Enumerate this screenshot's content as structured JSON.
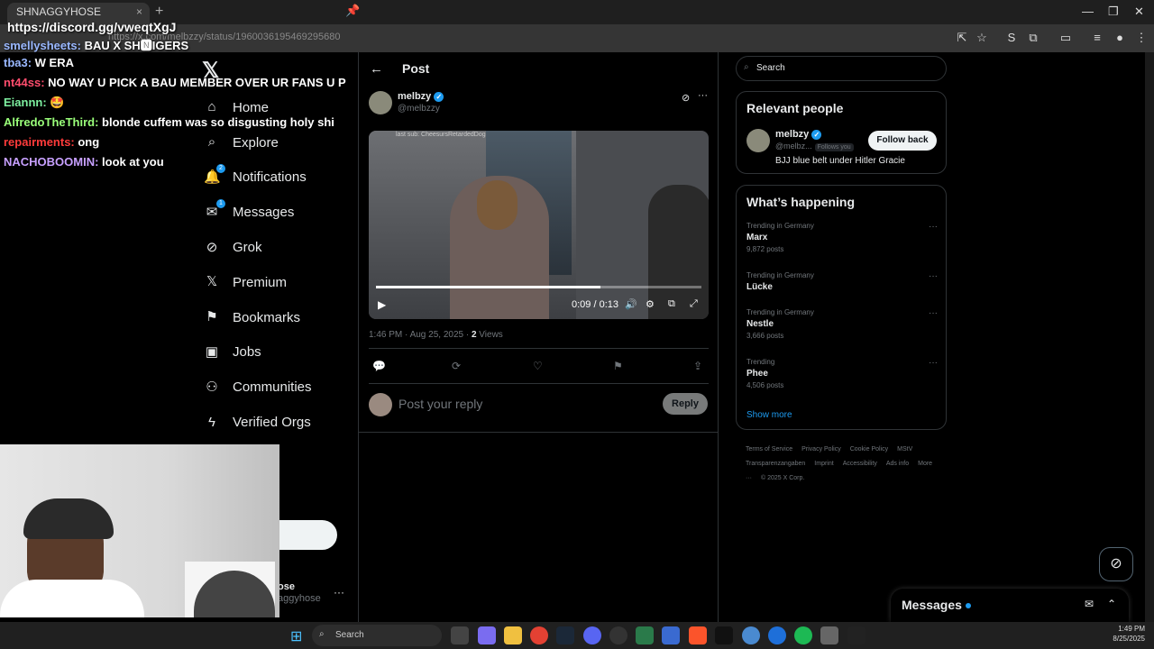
{
  "browser": {
    "tab_label": "SHNAGGYHOSE",
    "tab_close": "×",
    "new_tab": "+",
    "url": "https://x.com/melbzzy/status/1960036195469295680"
  },
  "overlay": {
    "discord": "https://discord.gg/vweqtXgJ",
    "chat": [
      {
        "user": "smellysheets:",
        "msg": " BAU X SH🅽IGERS",
        "cls": "u1"
      },
      {
        "user": "tba3:",
        "msg": " W ERA",
        "cls": "u1"
      },
      {
        "user": "nt44ss:",
        "msg": " NO WAY U PICK A BAU MEMBER OVER UR FANS U PUS",
        "cls": "u2"
      },
      {
        "user": "Eiannn:",
        "msg": " 🤩",
        "cls": "u3"
      },
      {
        "user": "AlfredoTheThird:",
        "msg": " blonde cuffem was so disgusting holy shi",
        "cls": "u4"
      },
      {
        "user": "repairments:",
        "msg": " ong",
        "cls": "u5"
      },
      {
        "user": "NACHOBOOMIN:",
        "msg": " look at you",
        "cls": "u6"
      }
    ]
  },
  "nav": {
    "logo": "𝕏",
    "items": [
      {
        "label": "Home",
        "icon": "⌂",
        "name": "home"
      },
      {
        "label": "Explore",
        "icon": "⌕",
        "name": "explore"
      },
      {
        "label": "Notifications",
        "icon": "🔔",
        "name": "notifications",
        "badge": "2"
      },
      {
        "label": "Messages",
        "icon": "✉",
        "name": "messages",
        "badge": "1"
      },
      {
        "label": "Grok",
        "icon": "⊘",
        "name": "grok"
      },
      {
        "label": "Premium",
        "icon": "𝕏",
        "name": "premium"
      },
      {
        "label": "Bookmarks",
        "icon": "⚑",
        "name": "bookmarks"
      },
      {
        "label": "Jobs",
        "icon": "▣",
        "name": "jobs"
      },
      {
        "label": "Communities",
        "icon": "⚇",
        "name": "communities"
      },
      {
        "label": "Verified Orgs",
        "icon": "ϟ",
        "name": "verified-orgs"
      }
    ],
    "account_fragment_name": "ose",
    "account_fragment_handle": "aggyhose"
  },
  "post": {
    "header": "Post",
    "author_name": "melbzy",
    "author_handle": "@melbzzy",
    "video_caption": "last sub: CheesursRetardedDog",
    "video_time": "0:09 / 0:13",
    "video_progress": 0.69,
    "timestamp": "1:46 PM · Aug 25, 2025 · ",
    "views_count": "2",
    "views_label": " Views",
    "reply_placeholder": "Post your reply",
    "reply_button": "Reply"
  },
  "right": {
    "search_placeholder": "Search",
    "relevant_title": "Relevant people",
    "relevant": {
      "name": "melbzy",
      "handle": "@melbz...",
      "follows_you": "Follows you",
      "follow_button": "Follow back",
      "bio": "BJJ blue belt under Hitler Gracie"
    },
    "happening_title": "What’s happening",
    "trends": [
      {
        "meta": "Trending in Germany",
        "name": "Marx",
        "count": "9,872 posts"
      },
      {
        "meta": "Trending in Germany",
        "name": "Lücke",
        "count": ""
      },
      {
        "meta": "Trending in Germany",
        "name": "Nestle",
        "count": "3,666 posts"
      },
      {
        "meta": "Trending",
        "name": "Phee",
        "count": "4,506 posts"
      }
    ],
    "show_more": "Show more",
    "footer_links": [
      "Terms of Service",
      "Privacy Policy",
      "Cookie Policy",
      "MStV Transparenzangaben",
      "Imprint",
      "Accessibility",
      "Ads info",
      "More ···",
      "© 2025 X Corp."
    ]
  },
  "messages_drawer": {
    "title": "Messages"
  },
  "taskbar": {
    "search_label": "Search",
    "time": "1:49 PM",
    "date": "8/25/2025"
  },
  "colors": {
    "accent": "#1d9bf0",
    "background": "#000000",
    "border": "#2f3336"
  }
}
